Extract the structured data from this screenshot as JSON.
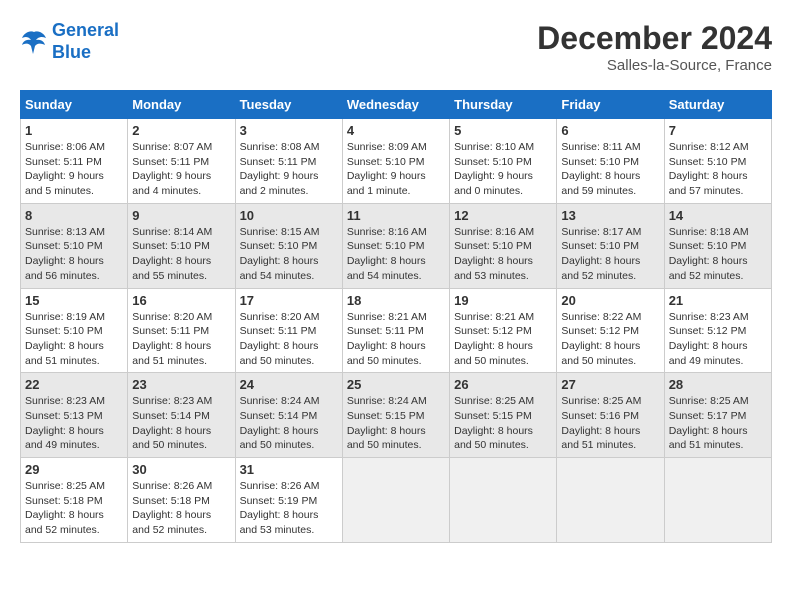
{
  "header": {
    "logo_line1": "General",
    "logo_line2": "Blue",
    "title": "December 2024",
    "subtitle": "Salles-la-Source, France"
  },
  "calendar": {
    "headers": [
      "Sunday",
      "Monday",
      "Tuesday",
      "Wednesday",
      "Thursday",
      "Friday",
      "Saturday"
    ],
    "weeks": [
      [
        {
          "day": "1",
          "sunrise": "8:06 AM",
          "sunset": "5:11 PM",
          "daylight": "9 hours and 5 minutes."
        },
        {
          "day": "2",
          "sunrise": "8:07 AM",
          "sunset": "5:11 PM",
          "daylight": "9 hours and 4 minutes."
        },
        {
          "day": "3",
          "sunrise": "8:08 AM",
          "sunset": "5:11 PM",
          "daylight": "9 hours and 2 minutes."
        },
        {
          "day": "4",
          "sunrise": "8:09 AM",
          "sunset": "5:10 PM",
          "daylight": "9 hours and 1 minute."
        },
        {
          "day": "5",
          "sunrise": "8:10 AM",
          "sunset": "5:10 PM",
          "daylight": "9 hours and 0 minutes."
        },
        {
          "day": "6",
          "sunrise": "8:11 AM",
          "sunset": "5:10 PM",
          "daylight": "8 hours and 59 minutes."
        },
        {
          "day": "7",
          "sunrise": "8:12 AM",
          "sunset": "5:10 PM",
          "daylight": "8 hours and 57 minutes."
        }
      ],
      [
        {
          "day": "8",
          "sunrise": "8:13 AM",
          "sunset": "5:10 PM",
          "daylight": "8 hours and 56 minutes."
        },
        {
          "day": "9",
          "sunrise": "8:14 AM",
          "sunset": "5:10 PM",
          "daylight": "8 hours and 55 minutes."
        },
        {
          "day": "10",
          "sunrise": "8:15 AM",
          "sunset": "5:10 PM",
          "daylight": "8 hours and 54 minutes."
        },
        {
          "day": "11",
          "sunrise": "8:16 AM",
          "sunset": "5:10 PM",
          "daylight": "8 hours and 54 minutes."
        },
        {
          "day": "12",
          "sunrise": "8:16 AM",
          "sunset": "5:10 PM",
          "daylight": "8 hours and 53 minutes."
        },
        {
          "day": "13",
          "sunrise": "8:17 AM",
          "sunset": "5:10 PM",
          "daylight": "8 hours and 52 minutes."
        },
        {
          "day": "14",
          "sunrise": "8:18 AM",
          "sunset": "5:10 PM",
          "daylight": "8 hours and 52 minutes."
        }
      ],
      [
        {
          "day": "15",
          "sunrise": "8:19 AM",
          "sunset": "5:10 PM",
          "daylight": "8 hours and 51 minutes."
        },
        {
          "day": "16",
          "sunrise": "8:20 AM",
          "sunset": "5:11 PM",
          "daylight": "8 hours and 51 minutes."
        },
        {
          "day": "17",
          "sunrise": "8:20 AM",
          "sunset": "5:11 PM",
          "daylight": "8 hours and 50 minutes."
        },
        {
          "day": "18",
          "sunrise": "8:21 AM",
          "sunset": "5:11 PM",
          "daylight": "8 hours and 50 minutes."
        },
        {
          "day": "19",
          "sunrise": "8:21 AM",
          "sunset": "5:12 PM",
          "daylight": "8 hours and 50 minutes."
        },
        {
          "day": "20",
          "sunrise": "8:22 AM",
          "sunset": "5:12 PM",
          "daylight": "8 hours and 50 minutes."
        },
        {
          "day": "21",
          "sunrise": "8:23 AM",
          "sunset": "5:12 PM",
          "daylight": "8 hours and 49 minutes."
        }
      ],
      [
        {
          "day": "22",
          "sunrise": "8:23 AM",
          "sunset": "5:13 PM",
          "daylight": "8 hours and 49 minutes."
        },
        {
          "day": "23",
          "sunrise": "8:23 AM",
          "sunset": "5:14 PM",
          "daylight": "8 hours and 50 minutes."
        },
        {
          "day": "24",
          "sunrise": "8:24 AM",
          "sunset": "5:14 PM",
          "daylight": "8 hours and 50 minutes."
        },
        {
          "day": "25",
          "sunrise": "8:24 AM",
          "sunset": "5:15 PM",
          "daylight": "8 hours and 50 minutes."
        },
        {
          "day": "26",
          "sunrise": "8:25 AM",
          "sunset": "5:15 PM",
          "daylight": "8 hours and 50 minutes."
        },
        {
          "day": "27",
          "sunrise": "8:25 AM",
          "sunset": "5:16 PM",
          "daylight": "8 hours and 51 minutes."
        },
        {
          "day": "28",
          "sunrise": "8:25 AM",
          "sunset": "5:17 PM",
          "daylight": "8 hours and 51 minutes."
        }
      ],
      [
        {
          "day": "29",
          "sunrise": "8:25 AM",
          "sunset": "5:18 PM",
          "daylight": "8 hours and 52 minutes."
        },
        {
          "day": "30",
          "sunrise": "8:26 AM",
          "sunset": "5:18 PM",
          "daylight": "8 hours and 52 minutes."
        },
        {
          "day": "31",
          "sunrise": "8:26 AM",
          "sunset": "5:19 PM",
          "daylight": "8 hours and 53 minutes."
        },
        null,
        null,
        null,
        null
      ]
    ]
  }
}
